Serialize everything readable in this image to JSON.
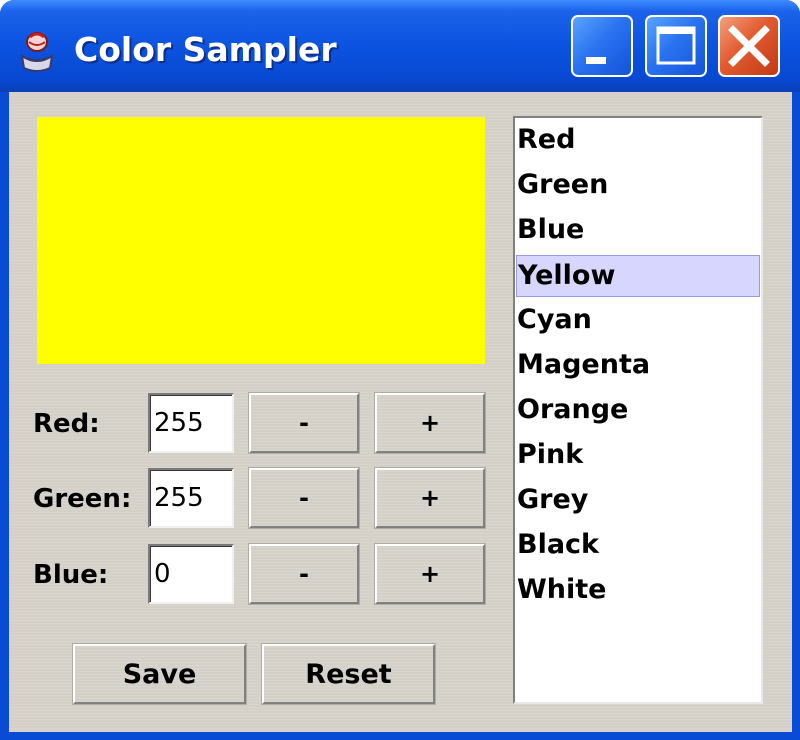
{
  "window": {
    "title": "Color Sampler",
    "controls": [
      "minimize",
      "maximize",
      "close"
    ]
  },
  "preview": {
    "color": "#ffff00"
  },
  "rows": [
    {
      "label": "Red:",
      "value": "255",
      "minus_label": "-",
      "plus_label": "+"
    },
    {
      "label": "Green:",
      "value": "255",
      "minus_label": "-",
      "plus_label": "+"
    },
    {
      "label": "Blue:",
      "value": "0",
      "minus_label": "-",
      "plus_label": "+"
    }
  ],
  "actions": {
    "save_label": "Save",
    "reset_label": "Reset"
  },
  "color_list": {
    "items": [
      "Red",
      "Green",
      "Blue",
      "Yellow",
      "Cyan",
      "Magenta",
      "Orange",
      "Pink",
      "Grey",
      "Black",
      "White"
    ],
    "selected": "Yellow"
  }
}
